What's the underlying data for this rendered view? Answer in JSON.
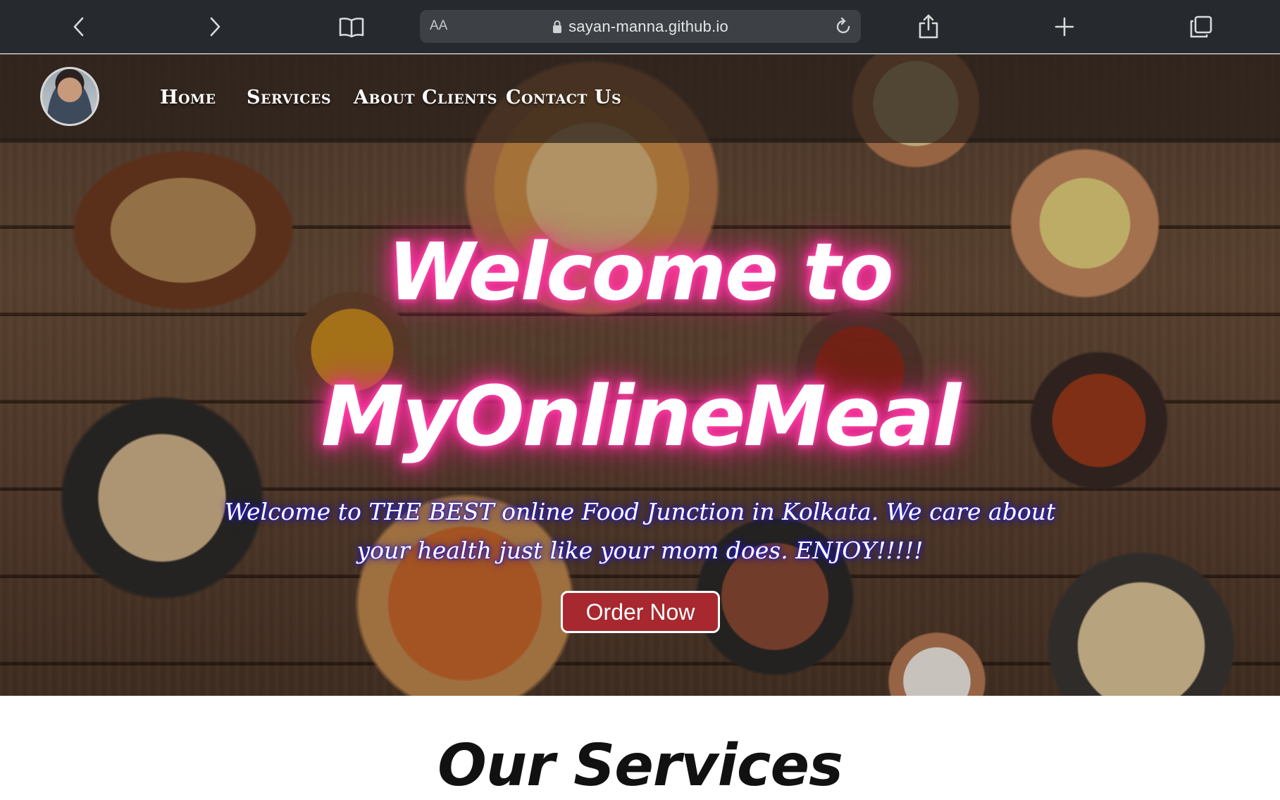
{
  "browser": {
    "url": "sayan-manna.github.io",
    "reader_label": "AA",
    "icons": {
      "back": "chevron-left-icon",
      "forward": "chevron-right-icon",
      "bookmarks": "book-icon",
      "lock": "lock-icon",
      "reload": "reload-icon",
      "share": "share-icon",
      "new_tab": "plus-icon",
      "tabs": "tabs-icon"
    }
  },
  "nav": {
    "items": [
      {
        "label": "Home"
      },
      {
        "label": "Services"
      },
      {
        "label": "About Clients"
      },
      {
        "label": "Contact Us"
      }
    ]
  },
  "hero": {
    "headline_line1": "Welcome to",
    "headline_line2": "MyOnlineMeal",
    "tagline": "Welcome to THE BEST online Food Junction in Kolkata. We care about your health just like your mom does. ENJOY!!!!!",
    "cta_label": "Order Now"
  },
  "services": {
    "title": "Our Services"
  },
  "colors": {
    "browser_bar": "#262a2e",
    "url_field": "#3d4146",
    "neon_pink": "#ff2fa0",
    "tagline_glow": "#2a1fd0",
    "cta_background": "#a8282f"
  }
}
